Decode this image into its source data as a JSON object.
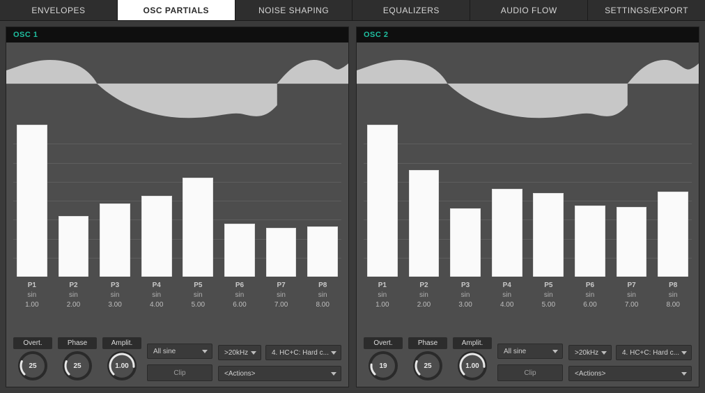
{
  "tabs": [
    {
      "label": "ENVELOPES",
      "active": false
    },
    {
      "label": "OSC PARTIALS",
      "active": true
    },
    {
      "label": "NOISE SHAPING",
      "active": false
    },
    {
      "label": "EQUALIZERS",
      "active": false
    },
    {
      "label": "AUDIO FLOW",
      "active": false
    },
    {
      "label": "SETTINGS/EXPORT",
      "active": false
    }
  ],
  "osc": [
    {
      "title": "OSC 1",
      "partials": [
        {
          "name": "P1",
          "type": "sin",
          "freq": "1.00"
        },
        {
          "name": "P2",
          "type": "sin",
          "freq": "2.00"
        },
        {
          "name": "P3",
          "type": "sin",
          "freq": "3.00"
        },
        {
          "name": "P4",
          "type": "sin",
          "freq": "4.00"
        },
        {
          "name": "P5",
          "type": "sin",
          "freq": "5.00"
        },
        {
          "name": "P6",
          "type": "sin",
          "freq": "6.00"
        },
        {
          "name": "P7",
          "type": "sin",
          "freq": "7.00"
        },
        {
          "name": "P8",
          "type": "sin",
          "freq": "8.00"
        }
      ],
      "knobs": {
        "overt": {
          "label": "Overt.",
          "value": "25",
          "frac": 0.25
        },
        "phase": {
          "label": "Phase",
          "value": "25",
          "frac": 0.25
        },
        "amplit": {
          "label": "Amplit.",
          "value": "1.00",
          "frac": 0.85
        }
      },
      "dropdowns": {
        "wave_preset": "All sine",
        "clip_button": "Clip",
        "freq_limit": ">20kHz",
        "hc_preset": "4. HC+C: Hard c...",
        "actions": "<Actions>"
      }
    },
    {
      "title": "OSC 2",
      "partials": [
        {
          "name": "P1",
          "type": "sin",
          "freq": "1.00"
        },
        {
          "name": "P2",
          "type": "sin",
          "freq": "2.00"
        },
        {
          "name": "P3",
          "type": "sin",
          "freq": "3.00"
        },
        {
          "name": "P4",
          "type": "sin",
          "freq": "4.00"
        },
        {
          "name": "P5",
          "type": "sin",
          "freq": "5.00"
        },
        {
          "name": "P6",
          "type": "sin",
          "freq": "6.00"
        },
        {
          "name": "P7",
          "type": "sin",
          "freq": "7.00"
        },
        {
          "name": "P8",
          "type": "sin",
          "freq": "8.00"
        }
      ],
      "knobs": {
        "overt": {
          "label": "Overt.",
          "value": "19",
          "frac": 0.19
        },
        "phase": {
          "label": "Phase",
          "value": "25",
          "frac": 0.25
        },
        "amplit": {
          "label": "Amplit.",
          "value": "1.00",
          "frac": 0.85
        }
      },
      "dropdowns": {
        "wave_preset": "All sine",
        "clip_button": "Clip",
        "freq_limit": ">20kHz",
        "hc_preset": "4. HC+C: Hard c...",
        "actions": "<Actions>"
      }
    }
  ],
  "chart_data": [
    {
      "type": "bar",
      "title": "OSC 1 partial amplitudes",
      "categories": [
        "P1",
        "P2",
        "P3",
        "P4",
        "P5",
        "P6",
        "P7",
        "P8"
      ],
      "values": [
        1.0,
        0.4,
        0.48,
        0.53,
        0.65,
        0.35,
        0.32,
        0.33
      ],
      "ylim": [
        0,
        1
      ]
    },
    {
      "type": "bar",
      "title": "OSC 2 partial amplitudes",
      "categories": [
        "P1",
        "P2",
        "P3",
        "P4",
        "P5",
        "P6",
        "P7",
        "P8"
      ],
      "values": [
        1.0,
        0.7,
        0.45,
        0.58,
        0.55,
        0.47,
        0.46,
        0.56
      ],
      "ylim": [
        0,
        1
      ]
    }
  ]
}
